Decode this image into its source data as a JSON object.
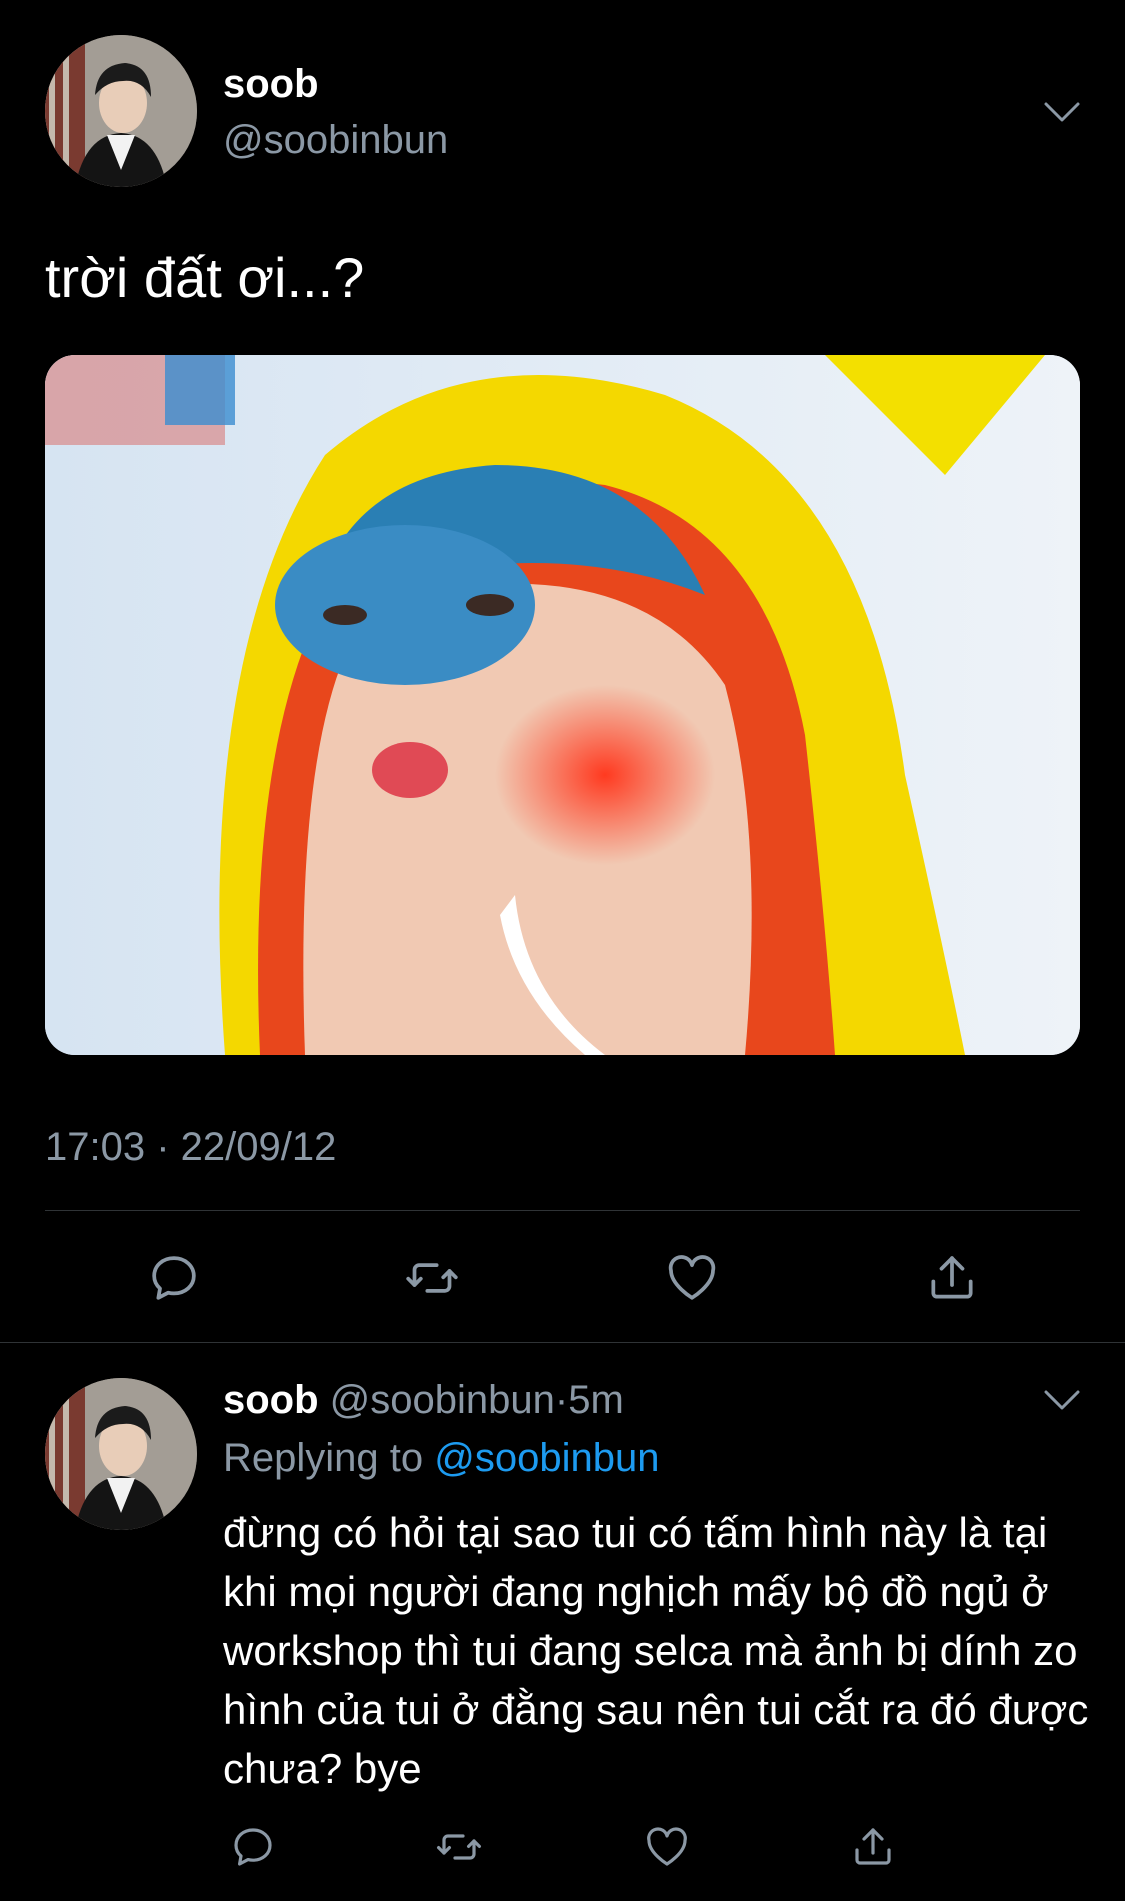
{
  "tweet": {
    "author_name": "soob",
    "author_handle": "@soobinbun",
    "text": "trời đất ơi...?",
    "timestamp": "17:03 · 22/09/12",
    "icons": {
      "more": "chevron-down-icon",
      "reply": "reply-bubble-icon",
      "retweet": "retweet-icon",
      "like": "heart-icon",
      "share": "share-icon"
    }
  },
  "reply": {
    "author_name": "soob",
    "author_handle": "@soobinbun",
    "separator": "·",
    "age": "5m",
    "replying_prefix": "Replying to",
    "replying_to": "@soobinbun",
    "text": "đừng có hỏi tại sao tui có tấm hình này là tại khi mọi người đang nghịch mấy bộ đồ ngủ ở workshop thì tui đang selca mà ảnh bị dính zo hình của tui ở đằng sau nên tui cắt ra đó được chưa? bye"
  },
  "colors": {
    "background": "#000000",
    "text_primary": "#ffffff",
    "text_secondary": "#8b98a5",
    "link": "#1d9bf0",
    "divider": "#2f3336"
  }
}
